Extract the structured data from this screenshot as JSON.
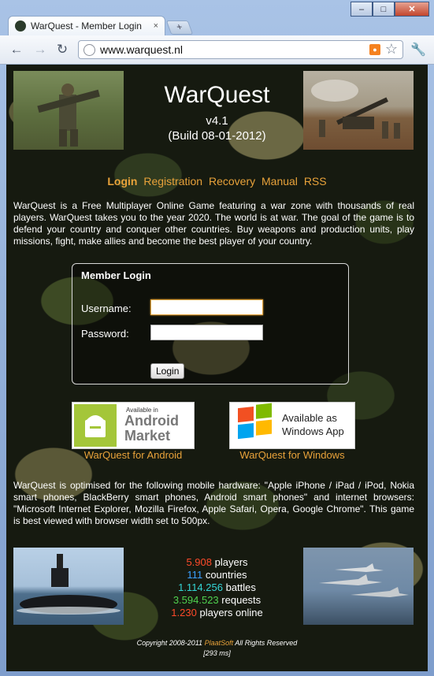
{
  "browser": {
    "tab_title": "WarQuest - Member Login",
    "tab_close": "×",
    "new_tab": "+",
    "url": "www.warquest.nl",
    "window_controls": [
      "–",
      "□",
      "✕"
    ]
  },
  "header": {
    "title": "WarQuest",
    "version": "v4.1",
    "build": "(Build 08-01-2012)"
  },
  "nav": {
    "items": [
      "Login",
      "Registration",
      "Recovery",
      "Manual",
      "RSS"
    ]
  },
  "intro": "WarQuest is a Free Multiplayer Online Game featuring a war zone with thousands of real players. WarQuest takes you to the year 2020. The world is at war. The goal of the game is to defend your country and conquer other countries. Buy weapons and production units, play missions, fight, make allies and become the best player of your country.",
  "login": {
    "heading": "Member Login",
    "username_label": "Username:",
    "password_label": "Password:",
    "username_value": "",
    "password_value": "",
    "button": "Login"
  },
  "apps": {
    "android_badge_small": "Available in",
    "android_badge_big1": "Android",
    "android_badge_big2": "Market",
    "android_link": "WarQuest for Android",
    "windows_badge_line1": "Available as",
    "windows_badge_line2": "Windows App",
    "windows_link": "WarQuest for Windows"
  },
  "optimised": "WarQuest is optimised for the following mobile hardware: \"Apple iPhone / iPad / iPod, Nokia smart phones, BlackBerry smart phones, Android smart phones\" and internet browsers: \"Microsoft Internet Explorer, Mozilla Firefox, Apple Safari, Opera, Google Chrome\". This game is best viewed with browser width set to 500px.",
  "stats": [
    {
      "value": "5.908",
      "label": "players",
      "color": "#ff4a2a"
    },
    {
      "value": "111",
      "label": "countries",
      "color": "#3aa0ff"
    },
    {
      "value": "1.114.256",
      "label": "battles",
      "color": "#33d6d6"
    },
    {
      "value": "3.594.523",
      "label": "requests",
      "color": "#4fd24f"
    },
    {
      "value": "1.230",
      "label": "players online",
      "color": "#ff4a2a"
    }
  ],
  "footer": {
    "copyright_pre": "Copyright 2008-2011",
    "brand": "PlaatSoft",
    "copyright_post": "All Rights Reserved",
    "timing": "[293 ms]"
  },
  "colors": {
    "accent": "#e8a23a",
    "page_bg": "#161a10"
  }
}
